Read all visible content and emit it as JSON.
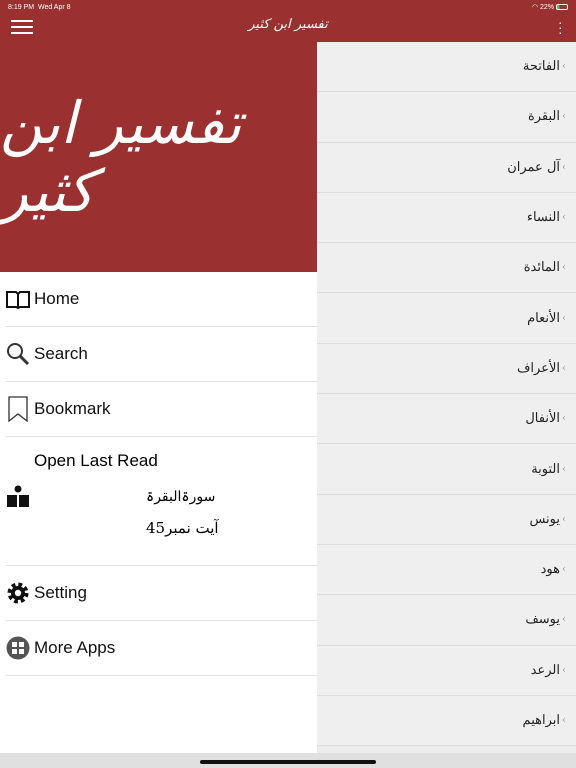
{
  "status": {
    "time": "8:19 PM",
    "date": "Wed Apr 8",
    "battery": "22%"
  },
  "nav": {
    "title": "تفسیر ابن کثیر"
  },
  "banner": {
    "title": "تفسیر ابن کثیر"
  },
  "drawer": {
    "items": [
      {
        "label": "Home",
        "icon": "book-open-icon"
      },
      {
        "label": "Search",
        "icon": "search-icon"
      },
      {
        "label": "Bookmark",
        "icon": "bookmark-icon"
      }
    ],
    "last_read": {
      "label": "Open Last Read",
      "surah": "سورۃالبقرۃ",
      "ayah": "آیت نمبر45"
    },
    "items2": [
      {
        "label": "Setting",
        "icon": "gear-icon"
      },
      {
        "label": "More Apps",
        "icon": "apps-icon"
      }
    ]
  },
  "surahs": [
    "الفاتحة",
    "البقرة",
    "آل عمران",
    "النساء",
    "المائدة",
    "الأنعام",
    "الأعراف",
    "الأنفال",
    "التوبة",
    "يونس",
    "هود",
    "يوسف",
    "الرعد",
    "ابراهيم"
  ],
  "colors": {
    "primary": "#9a3030"
  }
}
